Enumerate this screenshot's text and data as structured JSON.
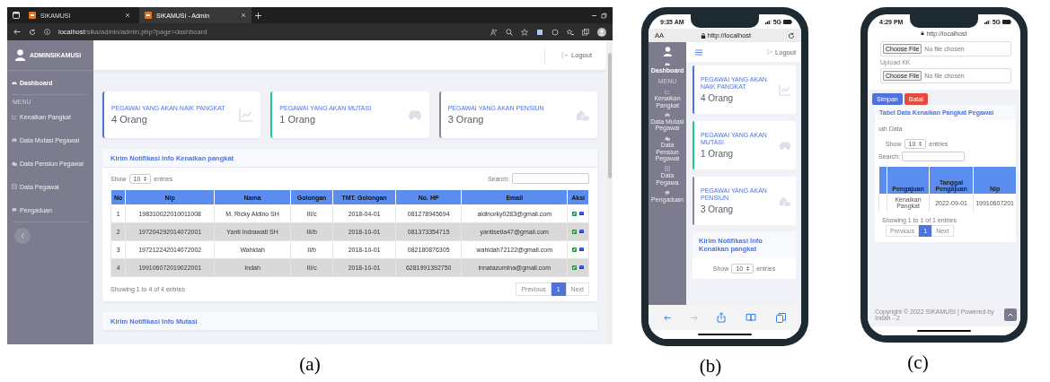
{
  "desktop_view": {
    "caption": "(a)",
    "browser": {
      "tabs": [
        {
          "title": "SIKAMUSI",
          "selected": false
        },
        {
          "title": "SIKAMUSI - Admin",
          "selected": true
        }
      ],
      "address": {
        "host": "localhost",
        "path": "/sika/admin/admin.php?page=dashboard"
      }
    },
    "sidebar": {
      "brand": "ADMINSIKAMUSI",
      "items": [
        {
          "label": "Dashboard",
          "selected": true
        }
      ],
      "section_label": "MENU",
      "menu_items": [
        {
          "label": "Kenaikan Pangkat",
          "selected": false
        },
        {
          "label": "Data Mutasi Pegawai",
          "selected": false
        },
        {
          "label": "Data Pensiun Pegawai",
          "selected": false
        },
        {
          "label": "Data Pegawai",
          "selected": false
        },
        {
          "label": "Pengaduan",
          "selected": false
        }
      ]
    },
    "header": {
      "logout": "Logout"
    },
    "stat_cards": [
      {
        "label": "PEGAWAI YANG AKAN NAIK PANGKAT",
        "value": "4 Orang",
        "color": "#4e73df"
      },
      {
        "label": "PEGAWAI YANG AKAN MUTASI",
        "value": "1 Orang",
        "color": "#1cc88a"
      },
      {
        "label": "PEGAWAI YANG AKAN PENSIUN",
        "value": "3 Orang",
        "color": "#858796"
      }
    ],
    "panel": {
      "title": "Kirim Notifikasi Info Kenaikan pangkat",
      "show_label": "Show",
      "page_size": "10",
      "entries_label": "entries",
      "search_label": "Search:",
      "columns": [
        "No",
        "Nip",
        "Nama",
        "Golongan",
        "TMT. Golongan",
        "No. HP",
        "Email",
        "Aksi"
      ],
      "rows": [
        [
          "1",
          "198310022010011008",
          "M. Ricky Aldino SH",
          "III/c",
          "2018-04-01",
          "081278945694",
          "aldinorky0283@gmail.com"
        ],
        [
          "2",
          "197204292014072001",
          "Yanti Indrawati SH",
          "III/b",
          "2018-10-01",
          "081373354715",
          "yantisetia47@gmail.com"
        ],
        [
          "3",
          "197212242014072002",
          "Wahidah",
          "II/b",
          "2018-10-01",
          "082180876305",
          "wahidah72122@gmail.com"
        ],
        [
          "4",
          "199106072019022001",
          "Indah",
          "III/c",
          "2018-10-01",
          "6281991392750",
          "innatazumina@gmail.com"
        ]
      ],
      "info": "Showing 1 to 4 of 4 entries",
      "pagination": [
        {
          "label": "Previous",
          "selected": false
        },
        {
          "label": "1",
          "selected": true
        },
        {
          "label": "Next",
          "selected": false
        }
      ]
    },
    "next_panel_title": "Kirim Notifikasi Info Mutasi"
  },
  "mobile_dashboard_view": {
    "caption": "(b)",
    "status_time": "9:35 AM",
    "network": "5G",
    "text_size": "AA",
    "url": "http://localhost",
    "sidebar": {
      "items": [
        {
          "label": "Dashboard",
          "selected": true
        }
      ],
      "section_label": "MENU",
      "menu_items": [
        {
          "label": "Kenaikan Pangkat",
          "selected": false
        },
        {
          "label": "Data Mutasi Pegawai",
          "selected": false
        },
        {
          "label": "Data Pensiun Pegawai",
          "selected": false
        },
        {
          "label": "Data Pegawa",
          "selected": false
        },
        {
          "label": "Pengaduan",
          "selected": false
        }
      ]
    },
    "logout": "Logout",
    "stat_cards": [
      {
        "label": "PEGAWAI YANG AKAN NAIK PANGKAT",
        "value": "4 Orang",
        "color": "#4e73df"
      },
      {
        "label": "PEGAWAI YANG AKAN MUTASI",
        "value": "1 Orang",
        "color": "#1cc88a"
      },
      {
        "label": "PEGAWAI YANG AKAN PENSIUN",
        "value": "3 Orang",
        "color": "#858796"
      }
    ],
    "panel": {
      "title": "Kirim Notifikasi Info Kenaikan pangkat",
      "show_label": "Show",
      "page_size": "10",
      "entries_label": "entries"
    }
  },
  "mobile_form_view": {
    "caption": "(c)",
    "status_time": "4:29 PM",
    "network": "5G",
    "url": "http://localhost",
    "file_fields": [
      {
        "button": "Choose File",
        "status": "No file chosen"
      },
      {
        "label": "Upload KK",
        "button": "Choose File",
        "status": "No file chosen"
      }
    ],
    "buttons": [
      {
        "label": "Simpan",
        "kind": "primary"
      },
      {
        "label": "Batal",
        "kind": "danger"
      }
    ],
    "panel": {
      "title": "Tabel Data Kenaikan Pangkat Pegawai",
      "add_text": "ıah Data",
      "show_label": "Show",
      "page_size": "10",
      "entries_label": "entries",
      "search_label": "Search:",
      "columns": [
        "Pengajuan",
        "Tanggal Pengajuan",
        "Nip"
      ],
      "rows": [
        [
          "Kenaikan Pangkat",
          "2022-09-01",
          "19910607201"
        ]
      ],
      "info": "Showing 1 to 1 of 1 entries",
      "pagination": [
        {
          "label": "Previous",
          "selected": false
        },
        {
          "label": "1",
          "selected": true
        },
        {
          "label": "Next",
          "selected": false
        }
      ]
    },
    "footer": "Copyright © 2022 SIKAMUSI | Powered by Indah - 2"
  }
}
